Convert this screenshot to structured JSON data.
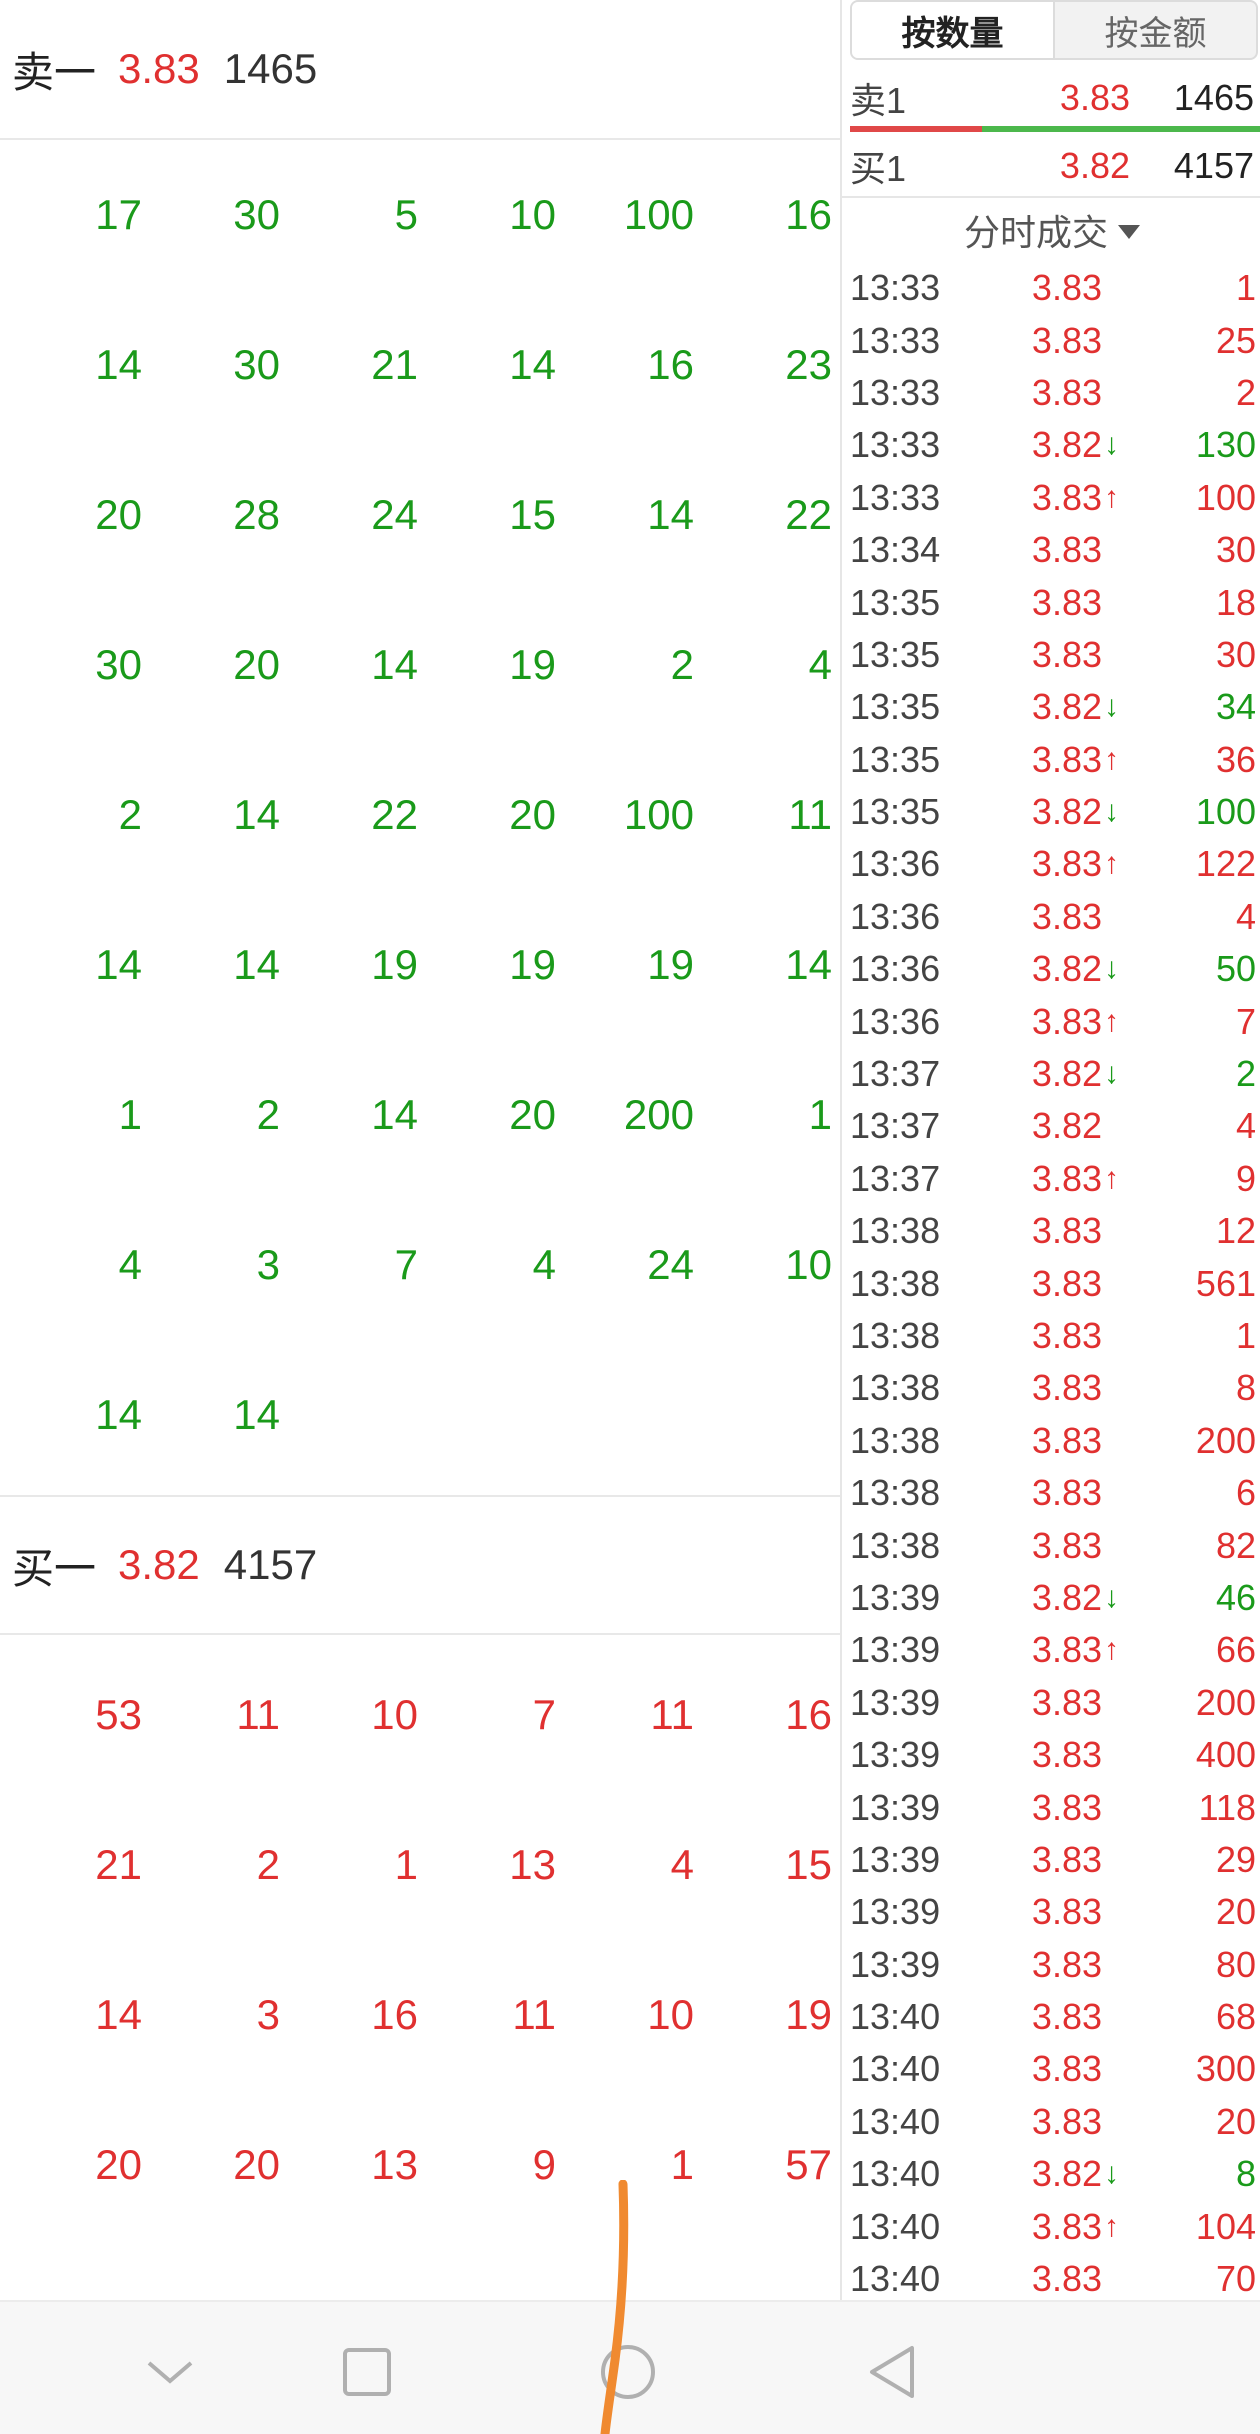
{
  "order_book": {
    "sell_header": {
      "label": "卖一",
      "price": "3.83",
      "volume": "1465"
    },
    "sell_orders": [
      [
        "17",
        "30",
        "5",
        "10",
        "100",
        "16"
      ],
      [
        "14",
        "30",
        "21",
        "14",
        "16",
        "23"
      ],
      [
        "20",
        "28",
        "24",
        "15",
        "14",
        "22"
      ],
      [
        "30",
        "20",
        "14",
        "19",
        "2",
        "4"
      ],
      [
        "2",
        "14",
        "22",
        "20",
        "100",
        "11"
      ],
      [
        "14",
        "14",
        "19",
        "19",
        "19",
        "14"
      ],
      [
        "1",
        "2",
        "14",
        "20",
        "200",
        "1"
      ],
      [
        "4",
        "3",
        "7",
        "4",
        "24",
        "10"
      ],
      [
        "14",
        "14"
      ]
    ],
    "buy_header": {
      "label": "买一",
      "price": "3.82",
      "volume": "4157"
    },
    "buy_orders": [
      [
        "53",
        "11",
        "10",
        "7",
        "11",
        "16"
      ],
      [
        "21",
        "2",
        "1",
        "13",
        "4",
        "15"
      ],
      [
        "14",
        "3",
        "16",
        "11",
        "10",
        "19"
      ],
      [
        "20",
        "20",
        "13",
        "9",
        "1",
        "57"
      ]
    ]
  },
  "right_panel": {
    "tabs": [
      {
        "label": "按数量",
        "active": true
      },
      {
        "label": "按金额",
        "active": false
      }
    ],
    "quote_sell": {
      "label": "卖1",
      "price": "3.83",
      "volume": "1465"
    },
    "quote_buy": {
      "label": "买1",
      "price": "3.82",
      "volume": "4157"
    },
    "sell_buy_ratio": 0.32,
    "ticks_title": "分时成交",
    "ticks": [
      {
        "time": "13:33",
        "price": "3.83",
        "dir": "",
        "vol": "1"
      },
      {
        "time": "13:33",
        "price": "3.83",
        "dir": "",
        "vol": "25"
      },
      {
        "time": "13:33",
        "price": "3.83",
        "dir": "",
        "vol": "2"
      },
      {
        "time": "13:33",
        "price": "3.82",
        "dir": "down",
        "vol": "130"
      },
      {
        "time": "13:33",
        "price": "3.83",
        "dir": "up",
        "vol": "100"
      },
      {
        "time": "13:34",
        "price": "3.83",
        "dir": "",
        "vol": "30"
      },
      {
        "time": "13:35",
        "price": "3.83",
        "dir": "",
        "vol": "18"
      },
      {
        "time": "13:35",
        "price": "3.83",
        "dir": "",
        "vol": "30"
      },
      {
        "time": "13:35",
        "price": "3.82",
        "dir": "down",
        "vol": "34"
      },
      {
        "time": "13:35",
        "price": "3.83",
        "dir": "up",
        "vol": "36"
      },
      {
        "time": "13:35",
        "price": "3.82",
        "dir": "down",
        "vol": "100"
      },
      {
        "time": "13:36",
        "price": "3.83",
        "dir": "up",
        "vol": "122"
      },
      {
        "time": "13:36",
        "price": "3.83",
        "dir": "",
        "vol": "4"
      },
      {
        "time": "13:36",
        "price": "3.82",
        "dir": "down",
        "vol": "50"
      },
      {
        "time": "13:36",
        "price": "3.83",
        "dir": "up",
        "vol": "7"
      },
      {
        "time": "13:37",
        "price": "3.82",
        "dir": "down",
        "vol": "2"
      },
      {
        "time": "13:37",
        "price": "3.82",
        "dir": "",
        "vol": "4"
      },
      {
        "time": "13:37",
        "price": "3.83",
        "dir": "up",
        "vol": "9"
      },
      {
        "time": "13:38",
        "price": "3.83",
        "dir": "",
        "vol": "12"
      },
      {
        "time": "13:38",
        "price": "3.83",
        "dir": "",
        "vol": "561"
      },
      {
        "time": "13:38",
        "price": "3.83",
        "dir": "",
        "vol": "1"
      },
      {
        "time": "13:38",
        "price": "3.83",
        "dir": "",
        "vol": "8"
      },
      {
        "time": "13:38",
        "price": "3.83",
        "dir": "",
        "vol": "200"
      },
      {
        "time": "13:38",
        "price": "3.83",
        "dir": "",
        "vol": "6"
      },
      {
        "time": "13:38",
        "price": "3.83",
        "dir": "",
        "vol": "82"
      },
      {
        "time": "13:39",
        "price": "3.82",
        "dir": "down",
        "vol": "46"
      },
      {
        "time": "13:39",
        "price": "3.83",
        "dir": "up",
        "vol": "66"
      },
      {
        "time": "13:39",
        "price": "3.83",
        "dir": "",
        "vol": "200"
      },
      {
        "time": "13:39",
        "price": "3.83",
        "dir": "",
        "vol": "400"
      },
      {
        "time": "13:39",
        "price": "3.83",
        "dir": "",
        "vol": "118"
      },
      {
        "time": "13:39",
        "price": "3.83",
        "dir": "",
        "vol": "29"
      },
      {
        "time": "13:39",
        "price": "3.83",
        "dir": "",
        "vol": "20"
      },
      {
        "time": "13:39",
        "price": "3.83",
        "dir": "",
        "vol": "80"
      },
      {
        "time": "13:40",
        "price": "3.83",
        "dir": "",
        "vol": "68"
      },
      {
        "time": "13:40",
        "price": "3.83",
        "dir": "",
        "vol": "300"
      },
      {
        "time": "13:40",
        "price": "3.83",
        "dir": "",
        "vol": "20"
      },
      {
        "time": "13:40",
        "price": "3.82",
        "dir": "down",
        "vol": "8"
      },
      {
        "time": "13:40",
        "price": "3.83",
        "dir": "up",
        "vol": "104"
      },
      {
        "time": "13:40",
        "price": "3.83",
        "dir": "",
        "vol": "70"
      }
    ]
  },
  "colors": {
    "up_red": "#e03030",
    "down_green": "#1a9a1a",
    "gesture_orange": "#f08a30"
  },
  "navbar": {
    "icons": [
      "chevron-down-icon",
      "square-icon",
      "circle-home-icon",
      "triangle-back-icon"
    ]
  }
}
